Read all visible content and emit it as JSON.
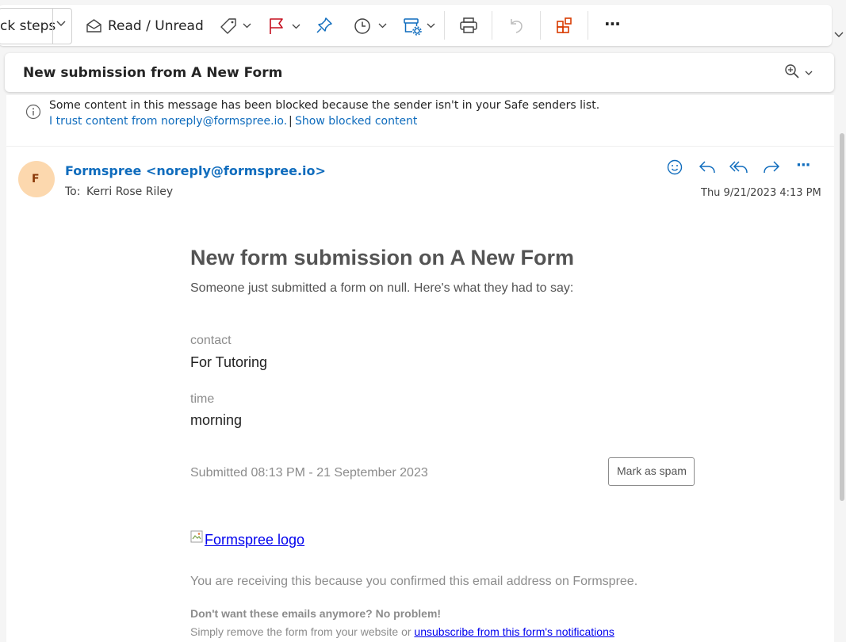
{
  "toolbar": {
    "quick_steps_label": "ck steps",
    "read_unread_label": "Read / Unread",
    "more_label": "···"
  },
  "subject": {
    "title": "New submission from A New Form"
  },
  "banner": {
    "line1": "Some content in this message has been blocked because the sender isn't in your Safe senders list.",
    "trust_link": "I trust content from noreply@formspree.io.",
    "separator": "|",
    "show_link": "Show blocked content"
  },
  "message": {
    "avatar_initial": "F",
    "sender": "Formspree <noreply@formspree.io>",
    "to_label": "To:",
    "to_name": "Kerri Rose Riley",
    "date": "Thu 9/21/2023 4:13 PM",
    "more_label": "···"
  },
  "email_body": {
    "heading": "New form submission on A New Form",
    "intro": "Someone just submitted a form on null. Here's what they had to say:",
    "fields": [
      {
        "label": "contact",
        "value": "For Tutoring"
      },
      {
        "label": "time",
        "value": "morning"
      }
    ],
    "submitted": "Submitted 08:13 PM - 21 September 2023",
    "spam_button": "Mark as spam",
    "logo_alt": "Formspree logo",
    "receiving": "You are receiving this because you confirmed this email address on Formspree.",
    "dont_want": "Don't want these emails anymore? No problem!",
    "remove_prefix": "Simply remove the form from your website or ",
    "unsubscribe_link": "unsubscribe from this form's notifications"
  },
  "colors": {
    "accent": "#0f6cbd",
    "flag": "#c50f1f",
    "apps": "#d83b01",
    "avatar_bg": "#fcd8ae",
    "avatar_fg": "#8a3707"
  }
}
